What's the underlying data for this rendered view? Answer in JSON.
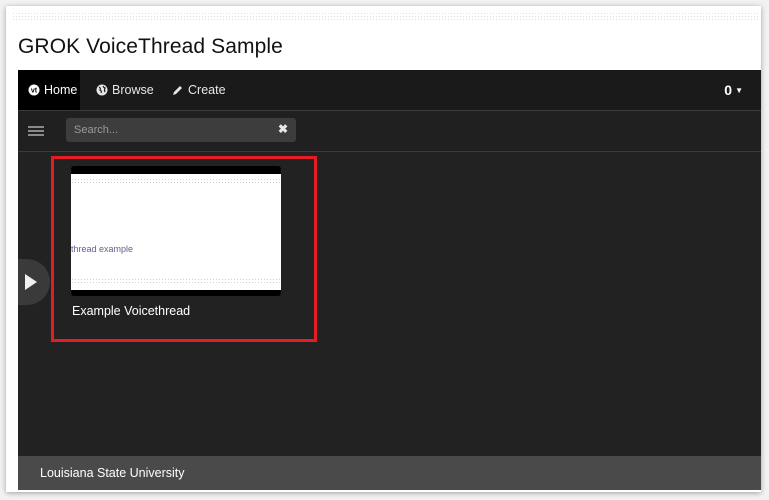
{
  "page": {
    "title": "GROK VoiceThread Sample"
  },
  "nav": {
    "items": [
      {
        "label": "Home",
        "icon": "voicethread-logo-icon",
        "active": true
      },
      {
        "label": "Browse",
        "icon": "globe-icon",
        "active": false
      },
      {
        "label": "Create",
        "icon": "pencil-icon",
        "active": false
      }
    ],
    "notifications": {
      "count": "0",
      "icon": "chevron-down-icon"
    }
  },
  "toolbar": {
    "menu_icon": "hamburger-menu-icon",
    "search": {
      "placeholder": "Search...",
      "value": "",
      "clear_icon": "close-icon"
    }
  },
  "threads": [
    {
      "title": "Example Voicethread",
      "thumbnail_text": "thread example"
    }
  ],
  "footer": {
    "text": "Louisiana State University"
  },
  "colors": {
    "highlight": "#e51c23",
    "nav_bg": "#1a1a1a",
    "content_bg": "#222222",
    "footer_bg": "#4a4a4a"
  }
}
